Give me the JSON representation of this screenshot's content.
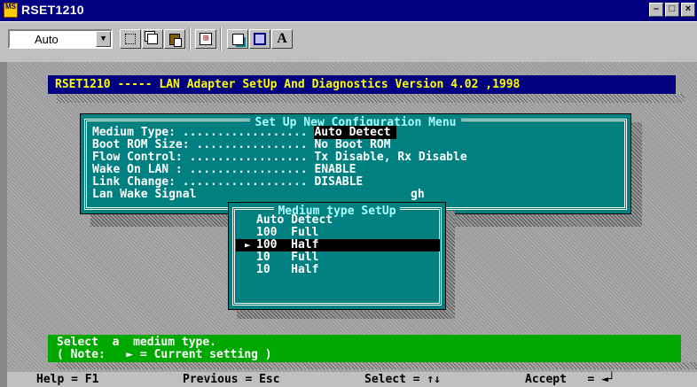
{
  "window": {
    "title": "RSET1210",
    "icon_text": "MS",
    "buttons": {
      "minimize": "–",
      "maximize": "□",
      "close": "×"
    }
  },
  "toolbar": {
    "font_size_value": "Auto",
    "font_label": "A",
    "fullscreen_glyph": "⊞",
    "icons": [
      "mark-icon",
      "copy-icon",
      "paste-icon",
      "fullscreen-icon",
      "properties-icon",
      "background-icon",
      "font-icon"
    ]
  },
  "header": {
    "text": "RSET1210 ----- LAN Adapter SetUp And Diagnostics Version 4.02 ,1998"
  },
  "config_menu": {
    "title": "Set Up New Configuration Menu",
    "rows": [
      {
        "label": "Medium Type: ",
        "dots": "..................",
        "value": "Auto Detect",
        "selected": true
      },
      {
        "label": "Boot ROM Size: ",
        "dots": "................",
        "value": "No Boot ROM"
      },
      {
        "label": "Flow Control: ",
        "dots": ".................",
        "value": "Tx Disable, Rx Disable"
      },
      {
        "label": "Wake On LAN : ",
        "dots": ".................",
        "value": "ENABLE"
      },
      {
        "label": "Link Change: ",
        "dots": "..................",
        "value": "DISABLE"
      },
      {
        "label": "Lan Wake Signal",
        "dots": "",
        "value": "gh"
      }
    ]
  },
  "submenu": {
    "title": "Medium type SetUp",
    "current_marker": "►",
    "options": [
      {
        "label": "Auto Detect"
      },
      {
        "label": "100  Full"
      },
      {
        "label": "100  Half",
        "selected": true
      },
      {
        "label": "10   Full"
      },
      {
        "label": "10   Half"
      }
    ]
  },
  "hint": {
    "line1": "Select  a  medium type.",
    "line2": "( Note:   ► = Current setting )"
  },
  "help_bar": {
    "help": "Help = F1",
    "previous": "Previous = Esc",
    "select": "Select = ↑↓",
    "accept": "Accept   = ◄┘"
  },
  "colors": {
    "title_bar": "#000080",
    "console_header_bg": "#000080",
    "console_header_fg": "#ffff00",
    "menu_bg": "#008080",
    "hint_bg": "#00a800",
    "selection_bg": "#000000"
  }
}
